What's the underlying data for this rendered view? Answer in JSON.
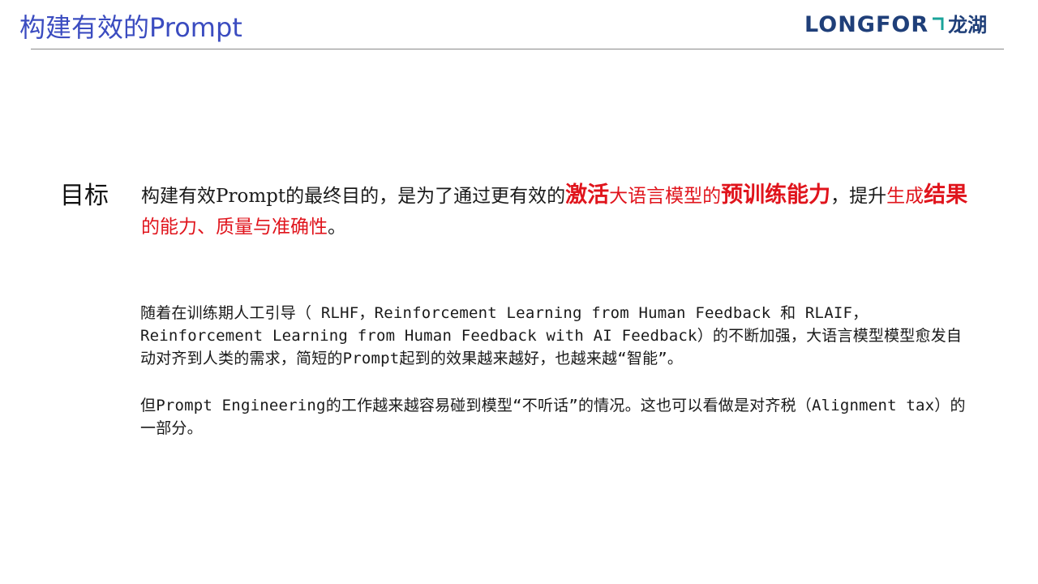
{
  "header": {
    "title": "构建有效的Prompt",
    "logo": {
      "text_en": "LONGFOR",
      "text_cn": "龙湖",
      "brand_color": "#1f3f79",
      "accent_color": "#1aa39a",
      "title_color": "#3b4cc0"
    }
  },
  "goal": {
    "label": "目标",
    "segments": [
      {
        "text": "构建有效Prompt的最终目的，是为了通过更有效的",
        "style": "plain"
      },
      {
        "text": "激活",
        "style": "red-strong"
      },
      {
        "text": "大语言模型的",
        "style": "red"
      },
      {
        "text": "预训练能力",
        "style": "red-strong"
      },
      {
        "text": "，提升",
        "style": "plain"
      },
      {
        "text": "生成",
        "style": "red"
      },
      {
        "text": "结果",
        "style": "red-strong"
      },
      {
        "text": "的能力、质量与准确性",
        "style": "red"
      },
      {
        "text": "。",
        "style": "plain"
      }
    ],
    "highlight_color": "#e0141c"
  },
  "paragraphs": [
    "随着在训练期人工引导（ RLHF，Reinforcement Learning from Human Feedback 和 RLAIF，Reinforcement Learning from Human Feedback with AI Feedback）的不断加强，大语言模型模型愈发自动对齐到人类的需求，简短的Prompt起到的效果越来越好，也越来越“智能”。",
    "但Prompt Engineering的工作越来越容易碰到模型“不听话”的情况。这也可以看做是对齐税（Alignment tax）的一部分。"
  ]
}
